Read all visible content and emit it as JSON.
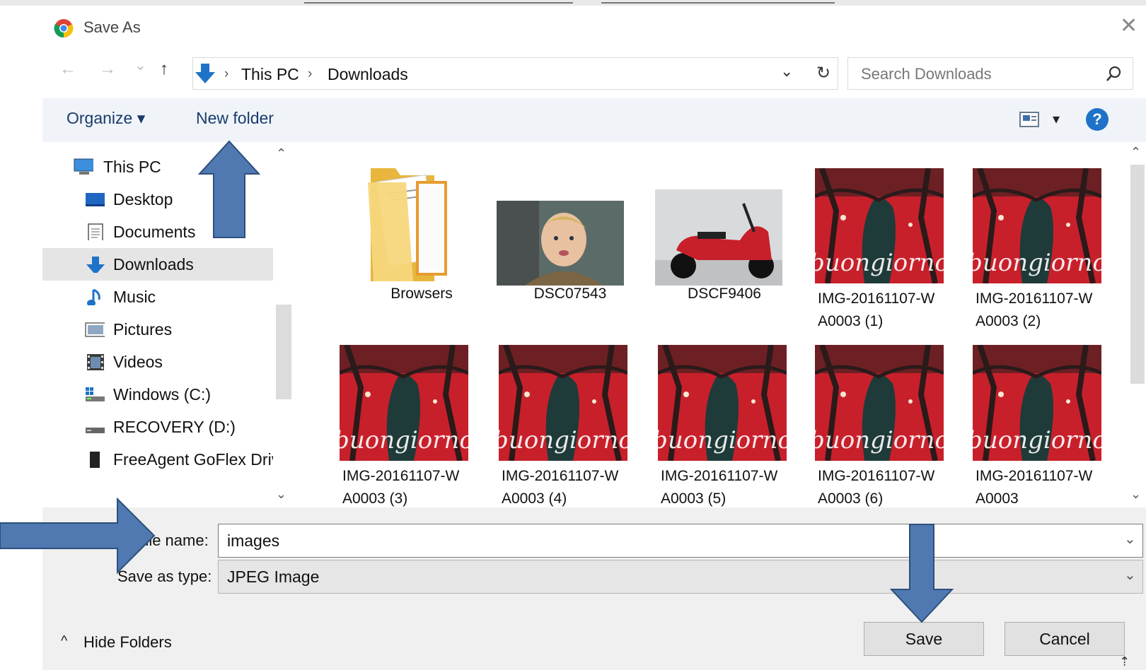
{
  "window": {
    "title": "Save As",
    "close_glyph": "✕"
  },
  "nav": {
    "back": "←",
    "forward": "→",
    "recent": "⌄",
    "up": "↑"
  },
  "address": {
    "crumbs": [
      "This PC",
      "Downloads"
    ],
    "separator": "›",
    "dropdown": "⌄",
    "refresh": "↻"
  },
  "search": {
    "placeholder": "Search Downloads"
  },
  "toolbar": {
    "organize": "Organize ▾",
    "new_folder": "New folder",
    "view_arrow": "▾",
    "help": "?"
  },
  "sidebar": {
    "items": [
      {
        "label": "This PC",
        "icon": "monitor-icon"
      },
      {
        "label": "Desktop",
        "icon": "desktop-icon"
      },
      {
        "label": "Documents",
        "icon": "documents-icon"
      },
      {
        "label": "Downloads",
        "icon": "downloads-icon",
        "selected": true
      },
      {
        "label": "Music",
        "icon": "music-icon"
      },
      {
        "label": "Pictures",
        "icon": "pictures-icon"
      },
      {
        "label": "Videos",
        "icon": "videos-icon"
      },
      {
        "label": "Windows (C:)",
        "icon": "drive-c-icon"
      },
      {
        "label": "RECOVERY (D:)",
        "icon": "drive-d-icon"
      },
      {
        "label": "FreeAgent GoFlex Driv",
        "icon": "external-drive-icon"
      }
    ]
  },
  "files": [
    {
      "name": "Browsers",
      "kind": "folder"
    },
    {
      "name": "DSC07543",
      "kind": "photo-child"
    },
    {
      "name": "DSCF9406",
      "kind": "photo-scooter"
    },
    {
      "name": "IMG-20161107-W\nA0003 (1)",
      "kind": "buongiorno"
    },
    {
      "name": "IMG-20161107-W\nA0003 (2)",
      "kind": "buongiorno"
    },
    {
      "name": "IMG-20161107-W\nA0003 (3)",
      "kind": "buongiorno"
    },
    {
      "name": "IMG-20161107-W\nA0003 (4)",
      "kind": "buongiorno"
    },
    {
      "name": "IMG-20161107-W\nA0003 (5)",
      "kind": "buongiorno"
    },
    {
      "name": "IMG-20161107-W\nA0003 (6)",
      "kind": "buongiorno"
    },
    {
      "name": "IMG-20161107-W\nA0003",
      "kind": "buongiorno"
    }
  ],
  "thumb_caption": "buongiorno",
  "form": {
    "file_name_label": "File name:",
    "file_name_value": "images",
    "save_type_label": "Save as type:",
    "save_type_value": "JPEG Image",
    "dropdown": "⌄"
  },
  "footer": {
    "hide_folders": "Hide Folders",
    "hide_chevron": "^",
    "save": "Save",
    "cancel": "Cancel"
  },
  "colors": {
    "toolbar_bg": "#f0f4f9",
    "selected_bg": "#e5e5e5",
    "bottom_bg": "#f0f0f0",
    "arrow_fill": "#4f79b0",
    "link": "#1a3b6b",
    "help": "#1e73c8"
  }
}
